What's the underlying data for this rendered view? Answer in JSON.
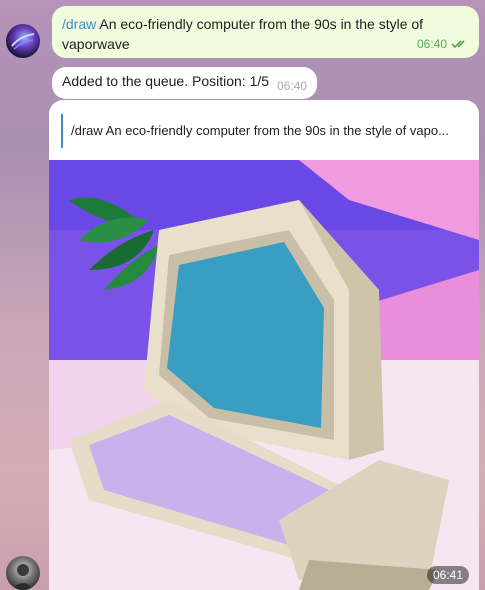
{
  "messages": {
    "outgoing": {
      "command": "/draw",
      "text": " An eco-friendly computer from the 90s in the style of vaporwave",
      "time": "06:40",
      "status_icon": "double-check-icon"
    },
    "queue": {
      "text": "Added to the queue. Position: 1/5",
      "time": "06:40"
    },
    "photo": {
      "reply_text": "/draw An eco-friendly computer from the 90s in the style of vapo...",
      "time": "06:41"
    }
  },
  "colors": {
    "outgoing_bubble": "#effdde",
    "incoming_bubble": "#ffffff",
    "link": "#3a8fc7",
    "read_check": "#57a551"
  }
}
